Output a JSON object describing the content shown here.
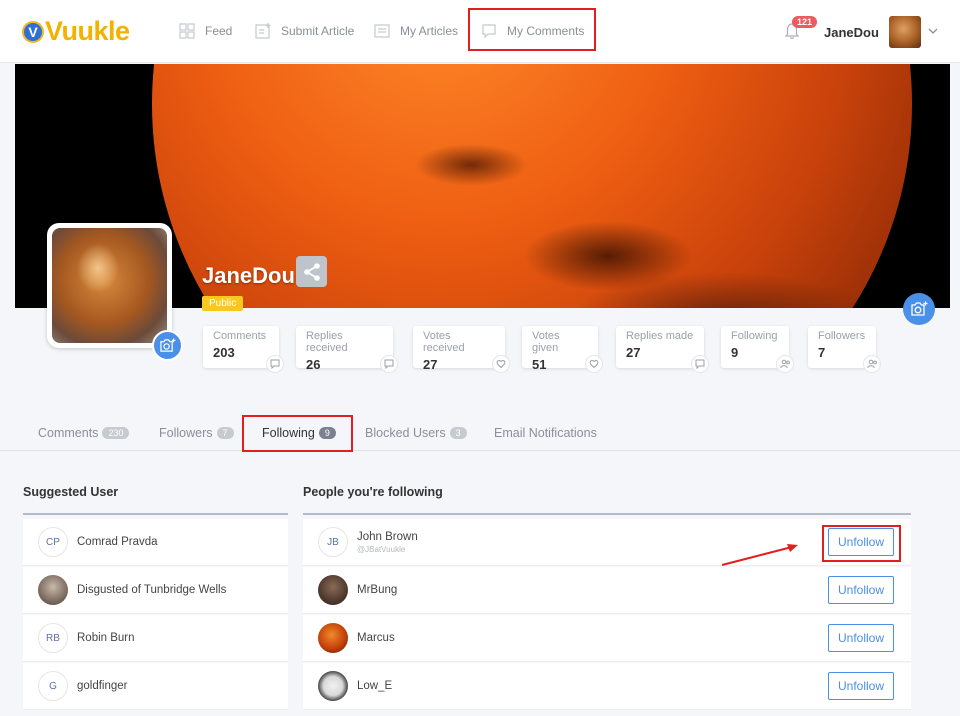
{
  "brand": {
    "logo_letter": "V",
    "logo_text": "Vuukle"
  },
  "nav": [
    {
      "label": "Feed",
      "icon": "grid-icon"
    },
    {
      "label": "Submit Article",
      "icon": "add-document-icon"
    },
    {
      "label": "My Articles",
      "icon": "articles-icon"
    },
    {
      "label": "My Comments",
      "icon": "comment-bubble-icon"
    }
  ],
  "header": {
    "notifications": "121",
    "username": "JaneDou"
  },
  "profile": {
    "name": "JaneDou",
    "visibility": "Public"
  },
  "stats": [
    {
      "label": "Comments",
      "value": "203",
      "icon": "comment-icon"
    },
    {
      "label": "Replies received",
      "value": "26",
      "icon": "reply-icon"
    },
    {
      "label": "Votes received",
      "value": "27",
      "icon": "heart-icon"
    },
    {
      "label": "Votes given",
      "value": "51",
      "icon": "heart-icon"
    },
    {
      "label": "Replies made",
      "value": "27",
      "icon": "reply-icon"
    },
    {
      "label": "Following",
      "value": "9",
      "icon": "users-icon"
    },
    {
      "label": "Followers",
      "value": "7",
      "icon": "users-icon"
    }
  ],
  "tabs": [
    {
      "label": "Comments",
      "count": "230"
    },
    {
      "label": "Followers",
      "count": "7"
    },
    {
      "label": "Following",
      "count": "9"
    },
    {
      "label": "Blocked Users",
      "count": "3"
    },
    {
      "label": "Email Notifications",
      "count": ""
    }
  ],
  "suggested": {
    "title": "Suggested User",
    "users": [
      {
        "initials": "CP",
        "name": "Comrad Pravda"
      },
      {
        "initials": "",
        "name": "Disgusted of Tunbridge Wells"
      },
      {
        "initials": "RB",
        "name": "Robin Burn"
      },
      {
        "initials": "G",
        "name": "goldfinger"
      }
    ]
  },
  "following": {
    "title": "People you're following",
    "button_label": "Unfollow",
    "users": [
      {
        "initials": "JB",
        "name": "John Brown",
        "handle": "@JBatVuukle"
      },
      {
        "initials": "",
        "name": "MrBung",
        "handle": ""
      },
      {
        "initials": "",
        "name": "Marcus",
        "handle": ""
      },
      {
        "initials": "",
        "name": "Low_E",
        "handle": ""
      }
    ]
  },
  "colors": {
    "accent": "#4a8fe8",
    "highlight": "#e02020",
    "brand": "#f2b200"
  }
}
